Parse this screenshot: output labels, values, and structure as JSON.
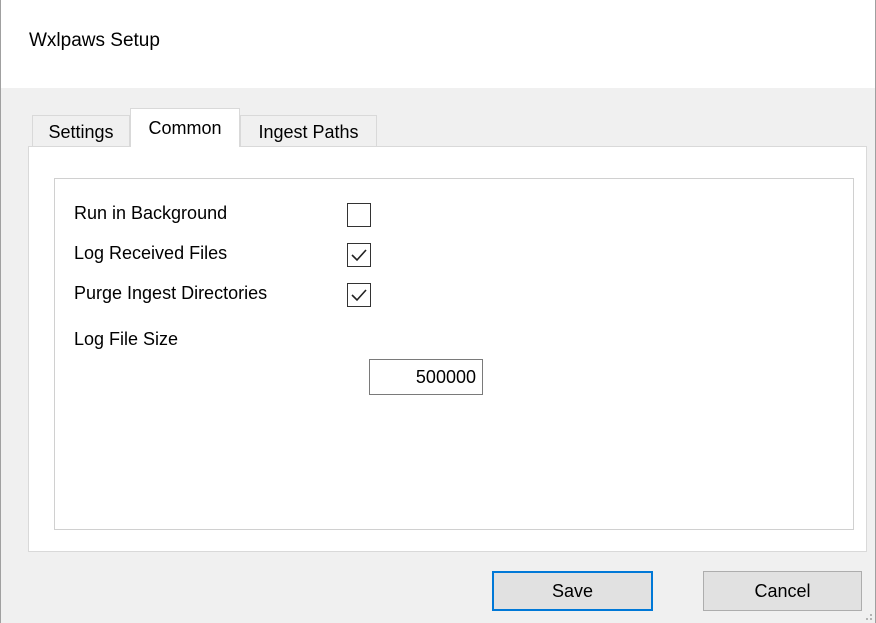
{
  "window": {
    "title": "Wxlpaws Setup"
  },
  "tabs": [
    {
      "label": "Settings",
      "active": false
    },
    {
      "label": "Common",
      "active": true
    },
    {
      "label": "Ingest Paths",
      "active": false
    }
  ],
  "common": {
    "run_in_background": {
      "label": "Run in Background",
      "checked": false
    },
    "log_received_files": {
      "label": "Log Received Files",
      "checked": true
    },
    "purge_ingest_directories": {
      "label": "Purge Ingest Directories",
      "checked": true
    },
    "log_file_size": {
      "label": "Log File Size",
      "value": "500000"
    }
  },
  "buttons": {
    "save_label": "Save",
    "cancel_label": "Cancel"
  },
  "colors": {
    "accent": "#0078d7",
    "panel": "#ffffff",
    "window": "#f0f0f0"
  }
}
